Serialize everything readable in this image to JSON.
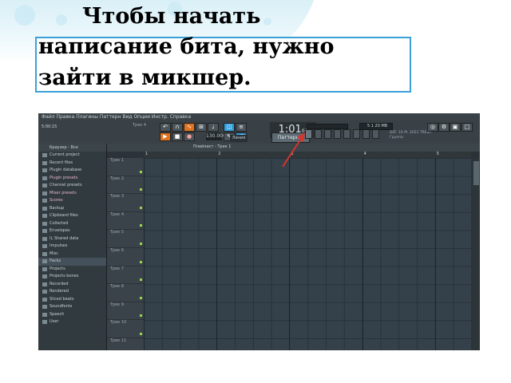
{
  "slide": {
    "title_lines": [
      "Чтобы начать",
      "написание бита, нужно",
      "зайти в микшер."
    ],
    "colors": {
      "caption_border": "#3aa0d8",
      "arrow": "#d9342b"
    }
  },
  "app": {
    "menu": "Файл Правка Плагины Паттерн Вид Опции Инстр. Справка",
    "song_info": "5:00:15",
    "pattern_label": "Трек 4",
    "time": "1:01",
    "time_sub": "00",
    "tempo": "130.000",
    "pattern_select": "Паттерн 1",
    "mode_select": "Линия",
    "cpu": "5 1   20 MB",
    "hint_line1": "DEF. 10 Pl. 2021 TRENT",
    "hint_line2": "Группа",
    "browser": {
      "header": "Браузер - Все",
      "items": [
        {
          "label": "Current project",
          "selected": false
        },
        {
          "label": "Recent files",
          "selected": false
        },
        {
          "label": "Plugin database",
          "selected": false
        },
        {
          "label": "Plugin presets",
          "selected": false,
          "pink": true
        },
        {
          "label": "Channel presets",
          "selected": false
        },
        {
          "label": "Mixer presets",
          "selected": false,
          "pink": true
        },
        {
          "label": "Scores",
          "selected": false,
          "pink": true
        },
        {
          "label": "Backup",
          "selected": false
        },
        {
          "label": "Clipboard files",
          "selected": false
        },
        {
          "label": "Collected",
          "selected": false
        },
        {
          "label": "Envelopes",
          "selected": false
        },
        {
          "label": "IL Shared data",
          "selected": false
        },
        {
          "label": "Impulses",
          "selected": false
        },
        {
          "label": "Misc",
          "selected": false
        },
        {
          "label": "Packs",
          "selected": true
        },
        {
          "label": "Projects",
          "selected": false
        },
        {
          "label": "Projects bones",
          "selected": false
        },
        {
          "label": "Recorded",
          "selected": false
        },
        {
          "label": "Rendered",
          "selected": false
        },
        {
          "label": "Sliced beats",
          "selected": false
        },
        {
          "label": "Soundfonts",
          "selected": false
        },
        {
          "label": "Speech",
          "selected": false
        },
        {
          "label": "User",
          "selected": false
        }
      ]
    },
    "playlist": {
      "title": "Плейлист - Трек 1",
      "ruler": [
        "1",
        "2",
        "3",
        "4",
        "5"
      ],
      "tracks": [
        "Трек 1",
        "Трек 2",
        "Трек 3",
        "Трек 4",
        "Трек 5",
        "Трек 6",
        "Трек 7",
        "Трек 8",
        "Трек 9",
        "Трек 10",
        "Трек 11"
      ]
    }
  }
}
